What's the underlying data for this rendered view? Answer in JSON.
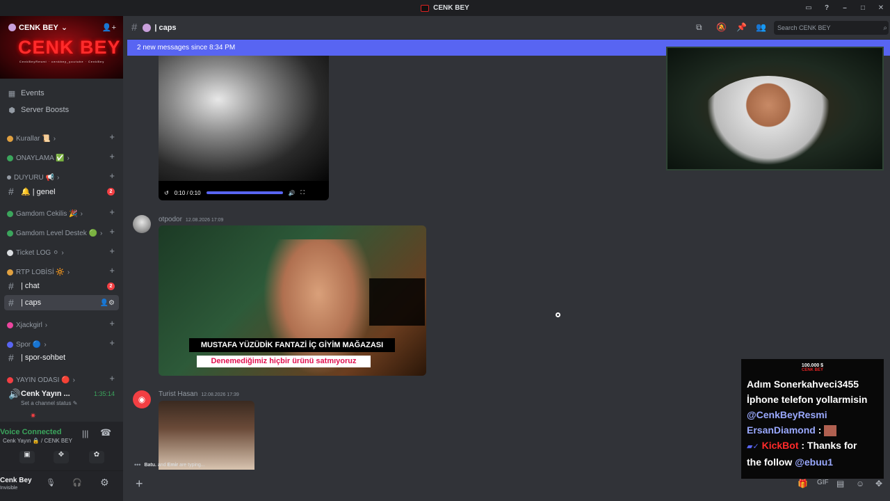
{
  "window": {
    "title": "CENK BEY",
    "controls": [
      "inbox",
      "help",
      "minimize",
      "maximize",
      "close"
    ]
  },
  "server": {
    "name": "CENK BEY",
    "banner_text": "CENK BEY",
    "banner_socials": "CenkBeyResmi · cenkbey_youtube · CenkBey"
  },
  "sidebar": {
    "top_items": [
      {
        "label": "Events",
        "icon": "calendar-icon"
      },
      {
        "label": "Server Boosts",
        "icon": "boost-icon"
      }
    ],
    "categories": [
      {
        "label": "Kurallar 📜",
        "color": "#e0a040"
      },
      {
        "label": "ONAYLAMA ✅",
        "color": "#3ba55c"
      },
      {
        "label": "DUYURU 📢",
        "color": "#949ba4"
      },
      {
        "label": "Gamdom Cekilis 🎉",
        "color": "#3ba55c"
      },
      {
        "label": "Gamdom Level Destek 🟢",
        "color": "#3ba55c"
      },
      {
        "label": "Ticket LOG ⚪",
        "color": "#dbdee1"
      },
      {
        "label": "RTP LOBİSİ 🔆",
        "color": "#e0a040"
      },
      {
        "label": "Xjackgirl",
        "color": "#eb459e"
      },
      {
        "label": "Spor 🔵",
        "color": "#5865f2"
      },
      {
        "label": "YAYIN ODASI 🔴",
        "color": "#f23f43"
      }
    ],
    "channels": [
      {
        "label": "🔔 | genel",
        "badge": "2"
      },
      {
        "label": "| chat",
        "badge": "2"
      },
      {
        "label": "| caps",
        "badge": ""
      },
      {
        "label": "| spor-sohbet",
        "badge": ""
      }
    ],
    "voice_channel": {
      "label": "Cenk Yayın ...",
      "timer": "1:35:14",
      "status": "Set a channel status"
    },
    "voice_panel": {
      "status": "Voice Connected",
      "location": "Cenk Yayın 🔒 / CENK BEY"
    },
    "user": {
      "name": "Cenk Bey",
      "status": "Invisible"
    }
  },
  "header": {
    "channel": "| caps",
    "search_placeholder": "Search CENK BEY"
  },
  "new_messages": {
    "text": "2 new messages since 8:34 PM"
  },
  "messages": [
    {
      "author": "",
      "video_time": "0:10 / 0:10",
      "progress": 1.0
    },
    {
      "author": "otpodor",
      "timestamp": "12.08.2026 17:09",
      "caption_title": "MUSTAFA YÜZÜDİK FANTAZİ İÇ GİYİM MAĞAZASI",
      "caption_sub": "Denemediğimiz hiçbir ürünü satmıyoruz"
    },
    {
      "author": "Turist Hasan",
      "timestamp": "12.08.2026 17:39"
    }
  ],
  "typing": {
    "names_a": "Batu.",
    "and": "and",
    "names_b": "Emir",
    "suffix": "are typing..."
  },
  "overlay": {
    "goal": "100.000 $",
    "brand": "CENK BEY",
    "line1": "Adım Sonerkahveci3455",
    "line2": "İphone telefon yollarmisin",
    "line3": "@CenkBeyResmi",
    "user2": "ErsanDiamond",
    "user3": "KickBot",
    "line4": ": Thanks for",
    "line5a": "the follow",
    "line5b": "@ebuu1"
  }
}
